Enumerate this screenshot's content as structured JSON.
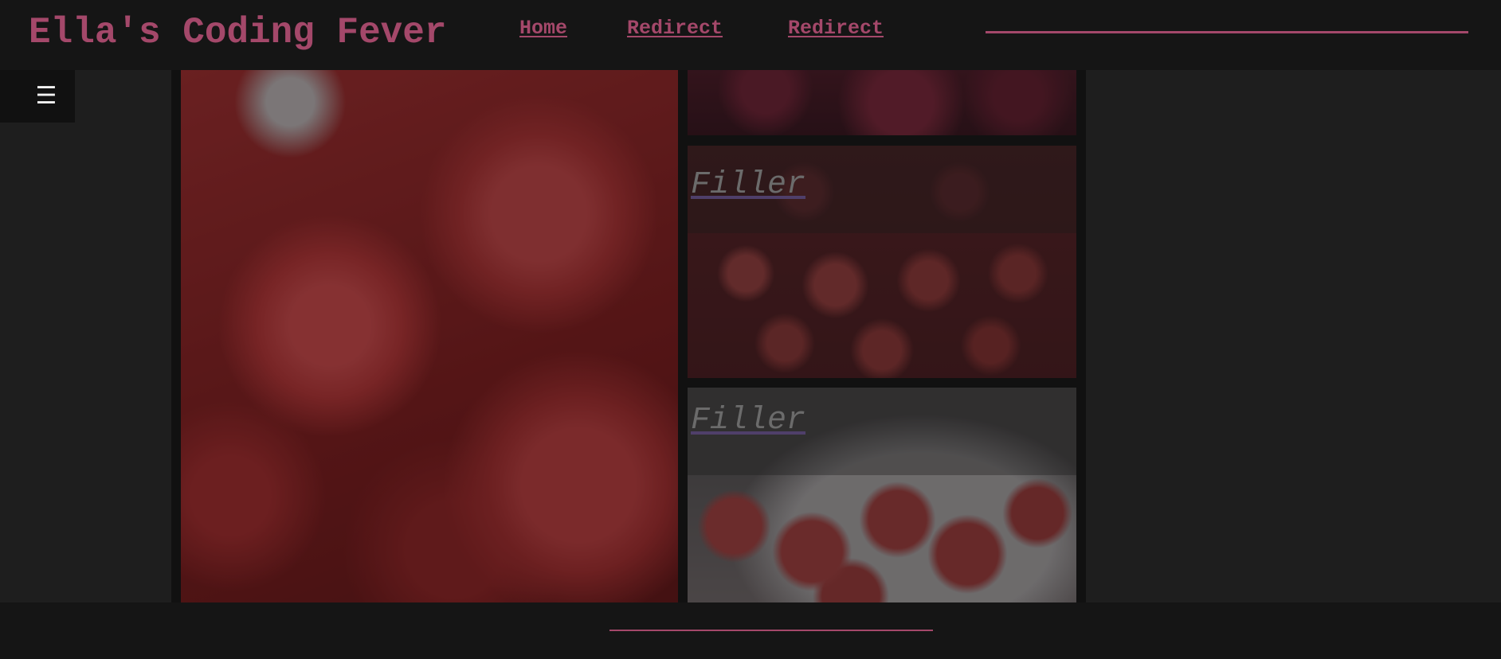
{
  "header": {
    "title": "Ella's Coding Fever",
    "nav": [
      {
        "label": "Home"
      },
      {
        "label": "Redirect"
      },
      {
        "label": "Redirect"
      }
    ]
  },
  "menu": {
    "icon": "hamburger-icon",
    "glyph": "☰"
  },
  "gallery": {
    "tiles": [
      {
        "image": "raspberries-closeup",
        "label": ""
      },
      {
        "image": "raspberries-dark",
        "label": ""
      },
      {
        "image": "raspberries-pile",
        "label": "Filler"
      },
      {
        "image": "raspberries-bowl",
        "label": "Filler"
      }
    ]
  },
  "colors": {
    "accent": "#a4486a",
    "header_bg": "#151515",
    "page_bg": "#1e1e1e",
    "filler_text": "#6b6b6b"
  }
}
